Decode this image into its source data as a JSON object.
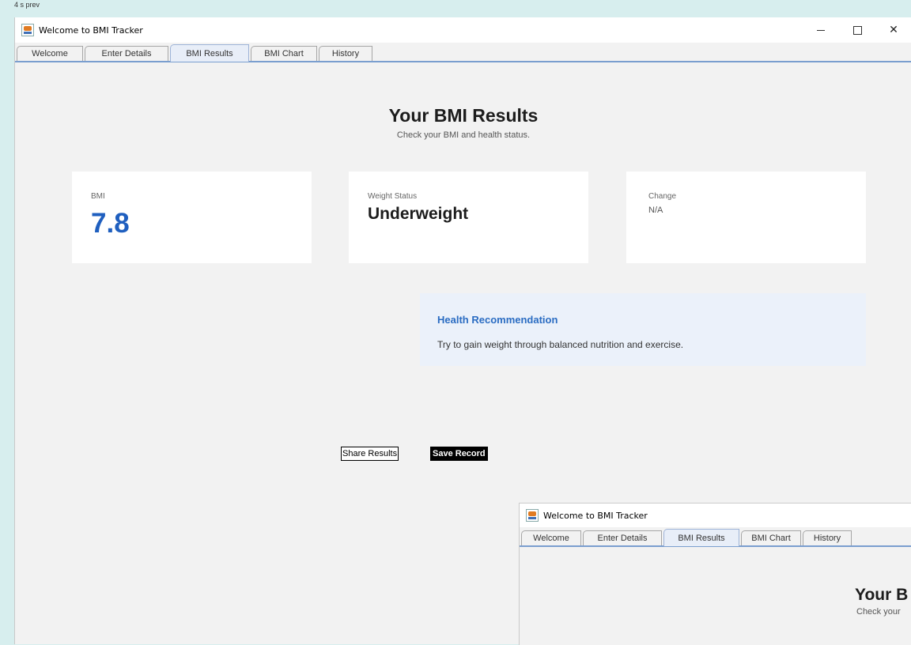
{
  "top_strip_text": "4 s prev",
  "window": {
    "title": "Welcome to BMI Tracker",
    "minimize_icon": "minimize-icon",
    "maximize_icon": "maximize-icon",
    "close_glyph": "✕"
  },
  "tabs": [
    {
      "label": "Welcome"
    },
    {
      "label": "Enter Details"
    },
    {
      "label": "BMI Results",
      "active": true
    },
    {
      "label": "BMI Chart"
    },
    {
      "label": "History"
    }
  ],
  "results": {
    "title": "Your BMI Results",
    "subtitle": "Check your BMI and health status.",
    "bmi_label": "BMI",
    "bmi_value": "7.8",
    "status_label": "Weight Status",
    "status_value": "Underweight",
    "change_label": "Change",
    "change_value": "N/A"
  },
  "recommendation": {
    "title": "Health Recommendation",
    "text": "Try to gain weight through balanced nutrition and exercise."
  },
  "actions": {
    "share_label": "Share Results",
    "save_label": "Save Record"
  },
  "second_window": {
    "title": "Welcome to BMI Tracker",
    "heading_partial": "Your B",
    "subtitle_partial": "Check your"
  },
  "colors": {
    "accent_blue": "#1f5fbf",
    "recommend_bg": "#ebf1fa",
    "desktop_bg": "#d7eeee"
  }
}
